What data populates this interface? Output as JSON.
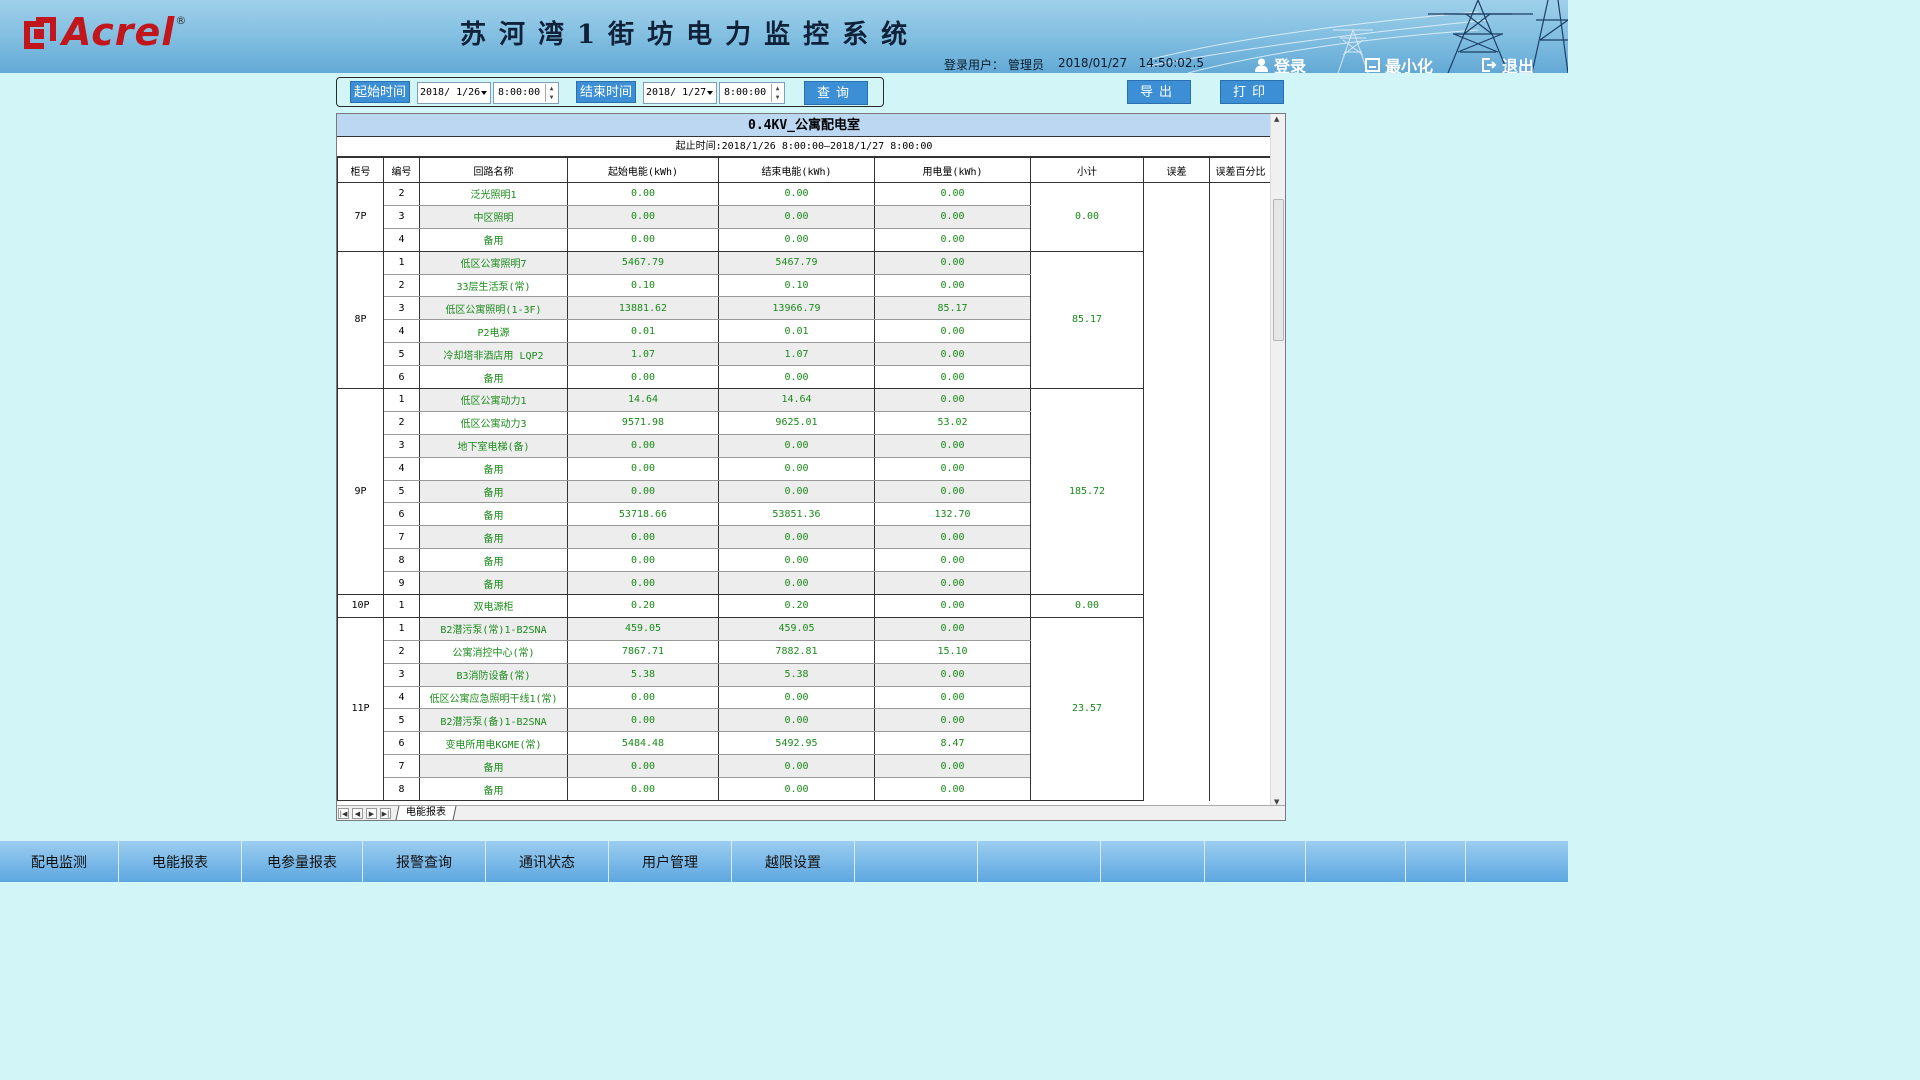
{
  "header": {
    "logo_text": "Acrel",
    "logo_reg": "®",
    "system_title": "苏河湾1街坊电力监控系统",
    "user_label": "登录用户：",
    "user_name": "管理员",
    "datetime": "2018/01/27   14:50:02.5",
    "login_label": "登录",
    "minimize_label": "最小化",
    "exit_label": "退出"
  },
  "query": {
    "start_label": "起始时间",
    "start_date": "2018/ 1/26",
    "start_time": "8:00:00",
    "end_label": "结束时间",
    "end_date": "2018/ 1/27",
    "end_time": "8:00:00",
    "query_label": "查询",
    "export_label": "导出",
    "print_label": "打印"
  },
  "report": {
    "title": "0.4KV_公寓配电室",
    "subtitle": "起止时间:2018/1/26 8:00:00—2018/1/27 8:00:00",
    "columns": [
      "柜号",
      "编号",
      "回路名称",
      "起始电能(kWh)",
      "结束电能(kWh)",
      "用电量(kWh)",
      "小计",
      "误差",
      "误差百分比"
    ],
    "groups": [
      {
        "cabinet": "7P",
        "subtotal": "0.00",
        "rows": [
          {
            "no": "2",
            "name": "泛光照明1",
            "start": "0.00",
            "end": "0.00",
            "usage": "0.00"
          },
          {
            "no": "3",
            "name": "中区照明",
            "start": "0.00",
            "end": "0.00",
            "usage": "0.00"
          },
          {
            "no": "4",
            "name": "备用",
            "start": "0.00",
            "end": "0.00",
            "usage": "0.00"
          }
        ]
      },
      {
        "cabinet": "8P",
        "subtotal": "85.17",
        "rows": [
          {
            "no": "1",
            "name": "低区公寓照明7",
            "start": "5467.79",
            "end": "5467.79",
            "usage": "0.00"
          },
          {
            "no": "2",
            "name": "33层生活泵(常)",
            "start": "0.10",
            "end": "0.10",
            "usage": "0.00"
          },
          {
            "no": "3",
            "name": "低区公寓照明(1-3F)",
            "start": "13881.62",
            "end": "13966.79",
            "usage": "85.17"
          },
          {
            "no": "4",
            "name": "P2电源",
            "start": "0.01",
            "end": "0.01",
            "usage": "0.00"
          },
          {
            "no": "5",
            "name": "冷却塔非酒店用 LQP2",
            "start": "1.07",
            "end": "1.07",
            "usage": "0.00"
          },
          {
            "no": "6",
            "name": "备用",
            "start": "0.00",
            "end": "0.00",
            "usage": "0.00"
          }
        ]
      },
      {
        "cabinet": "9P",
        "subtotal": "185.72",
        "rows": [
          {
            "no": "1",
            "name": "低区公寓动力1",
            "start": "14.64",
            "end": "14.64",
            "usage": "0.00"
          },
          {
            "no": "2",
            "name": "低区公寓动力3",
            "start": "9571.98",
            "end": "9625.01",
            "usage": "53.02"
          },
          {
            "no": "3",
            "name": "地下室电梯(备)",
            "start": "0.00",
            "end": "0.00",
            "usage": "0.00"
          },
          {
            "no": "4",
            "name": "备用",
            "start": "0.00",
            "end": "0.00",
            "usage": "0.00"
          },
          {
            "no": "5",
            "name": "备用",
            "start": "0.00",
            "end": "0.00",
            "usage": "0.00"
          },
          {
            "no": "6",
            "name": "备用",
            "start": "53718.66",
            "end": "53851.36",
            "usage": "132.70"
          },
          {
            "no": "7",
            "name": "备用",
            "start": "0.00",
            "end": "0.00",
            "usage": "0.00"
          },
          {
            "no": "8",
            "name": "备用",
            "start": "0.00",
            "end": "0.00",
            "usage": "0.00"
          },
          {
            "no": "9",
            "name": "备用",
            "start": "0.00",
            "end": "0.00",
            "usage": "0.00"
          }
        ]
      },
      {
        "cabinet": "10P",
        "subtotal": "0.00",
        "rows": [
          {
            "no": "1",
            "name": "双电源柜",
            "start": "0.20",
            "end": "0.20",
            "usage": "0.00"
          }
        ]
      },
      {
        "cabinet": "11P",
        "subtotal": "23.57",
        "rows": [
          {
            "no": "1",
            "name": "B2潜污泵(常)1-B2SNA",
            "start": "459.05",
            "end": "459.05",
            "usage": "0.00"
          },
          {
            "no": "2",
            "name": "公寓消控中心(常)",
            "start": "7867.71",
            "end": "7882.81",
            "usage": "15.10"
          },
          {
            "no": "3",
            "name": "B3消防设备(常)",
            "start": "5.38",
            "end": "5.38",
            "usage": "0.00"
          },
          {
            "no": "4",
            "name": "低区公寓应急照明干线1(常)",
            "start": "0.00",
            "end": "0.00",
            "usage": "0.00"
          },
          {
            "no": "5",
            "name": "B2潜污泵(备)1-B2SNA",
            "start": "0.00",
            "end": "0.00",
            "usage": "0.00"
          },
          {
            "no": "6",
            "name": "变电所用电KGME(常)",
            "start": "5484.48",
            "end": "5492.95",
            "usage": "8.47"
          },
          {
            "no": "7",
            "name": "备用",
            "start": "0.00",
            "end": "0.00",
            "usage": "0.00"
          },
          {
            "no": "8",
            "name": "备用",
            "start": "0.00",
            "end": "0.00",
            "usage": "0.00"
          }
        ]
      }
    ],
    "sheet_tab": "电能报表"
  },
  "nav": {
    "items": [
      "配电监测",
      "电能报表",
      "电参量报表",
      "报警查询",
      "通讯状态",
      "用户管理",
      "越限设置",
      "",
      "",
      "",
      "",
      "",
      ""
    ]
  },
  "colors": {
    "header_blue": "#7fbde0",
    "button_blue": "#3c8fd4",
    "value_green": "#1a8a1a",
    "logo_red": "#c0161c",
    "page_bg": "#d2f5f7"
  }
}
